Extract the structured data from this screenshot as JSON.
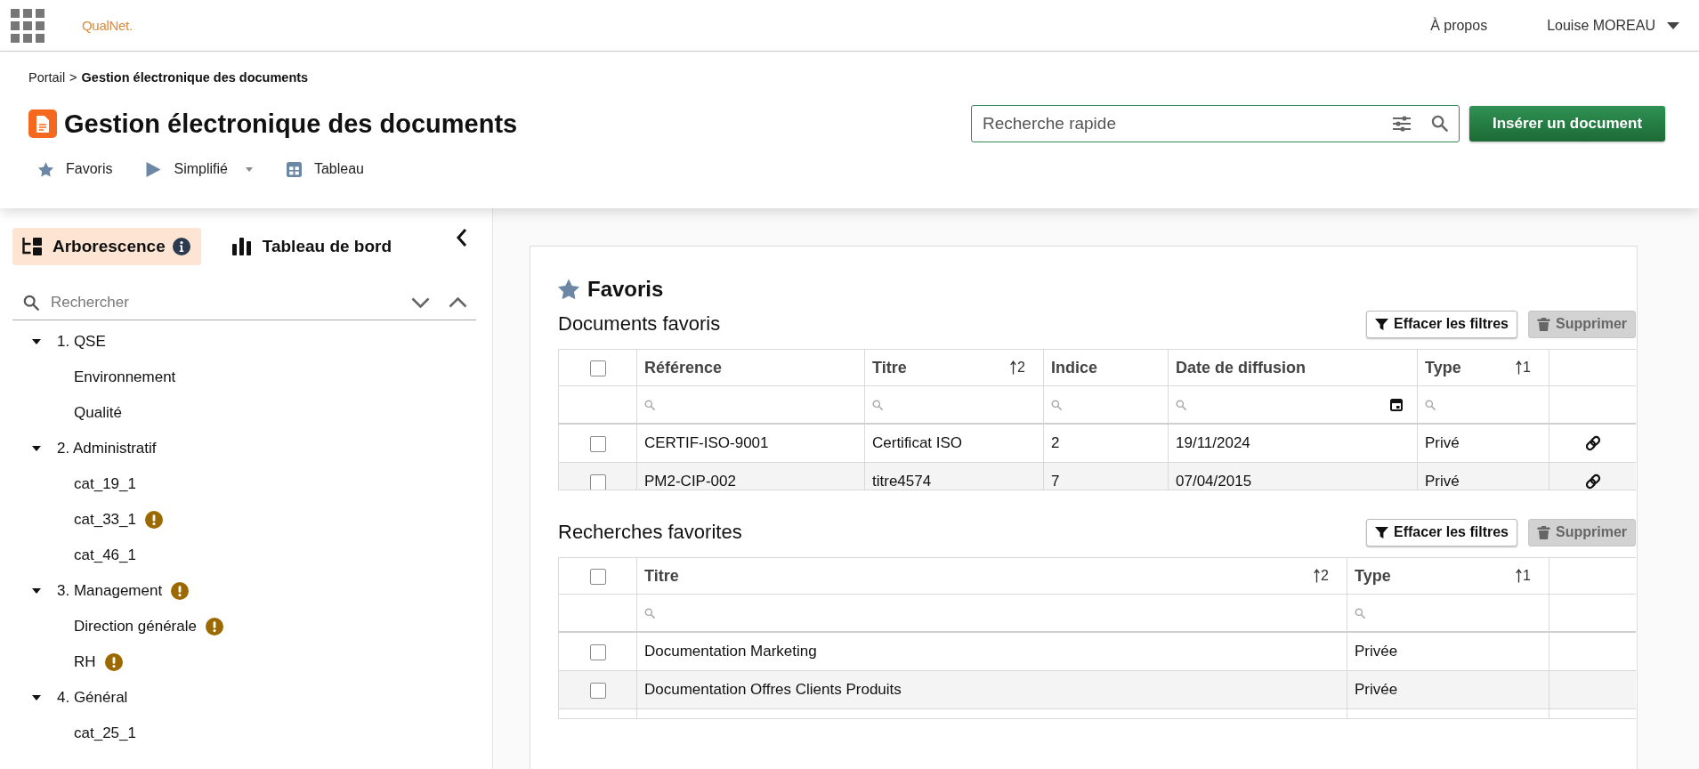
{
  "top_bar": {
    "logo": "QualNet.",
    "links": [
      {
        "label": "À propos"
      }
    ],
    "user": {
      "name": "Louise MOREAU"
    }
  },
  "header": {
    "breadcrumb": {
      "items": [
        {
          "label": "Portail",
          "current": false
        },
        {
          "label": "Gestion électronique des documents",
          "current": true
        }
      ],
      "separator": ">"
    },
    "title": "Gestion électronique des documents",
    "views": [
      {
        "label": "Favoris",
        "dropdown": false
      },
      {
        "label": "Simplifié",
        "dropdown": true
      },
      {
        "label": "Tableau",
        "dropdown": false
      }
    ],
    "search": {
      "placeholder": "Recherche rapide"
    },
    "insert_button": "Insérer un document"
  },
  "sidebar": {
    "tabs": [
      {
        "label": "Arborescence",
        "selected": true
      },
      {
        "label": "Tableau de bord",
        "selected": false
      }
    ],
    "search": {
      "placeholder": "Rechercher"
    },
    "tree": [
      {
        "label": "1. QSE",
        "expanded": true,
        "warning": false,
        "children": [
          {
            "label": "Environnement",
            "warning": false
          },
          {
            "label": "Qualité",
            "warning": false
          }
        ]
      },
      {
        "label": "2. Administratif",
        "expanded": true,
        "warning": false,
        "children": [
          {
            "label": "cat_19_1",
            "warning": false
          },
          {
            "label": "cat_33_1",
            "warning": true
          },
          {
            "label": "cat_46_1",
            "warning": false
          }
        ]
      },
      {
        "label": "3. Management",
        "expanded": true,
        "warning": true,
        "children": [
          {
            "label": "Direction générale",
            "warning": true
          },
          {
            "label": "RH",
            "warning": true
          }
        ]
      },
      {
        "label": "4. Général",
        "expanded": true,
        "warning": false,
        "children": [
          {
            "label": "cat_25_1",
            "warning": false
          }
        ]
      }
    ]
  },
  "favorites": {
    "title": "Favoris",
    "sections": [
      {
        "title": "Documents favoris",
        "buttons": [
          {
            "label": "Effacer les filtres",
            "kind": "filter",
            "disabled": false
          },
          {
            "label": "Supprimer",
            "kind": "delete",
            "disabled": true
          }
        ],
        "header_checked": false,
        "columns": [
          {
            "label": "Référence",
            "kind": "text"
          },
          {
            "label": "Titre",
            "sort": "2",
            "kind": "text"
          },
          {
            "label": "Indice",
            "kind": "text"
          },
          {
            "label": "Date de diffusion",
            "kind": "date"
          },
          {
            "label": "Type",
            "sort": "1",
            "kind": "text"
          }
        ],
        "rows": [
          {
            "checked": false,
            "link": true,
            "cells": [
              "CERTIF-ISO-9001",
              "Certificat ISO",
              "2",
              "19/11/2024",
              "Privé"
            ]
          },
          {
            "checked": false,
            "link": true,
            "cells": [
              "PM2-CIP-002",
              "titre4574",
              "7",
              "07/04/2015",
              "Privé"
            ]
          }
        ]
      },
      {
        "title": "Recherches favorites",
        "buttons": [
          {
            "label": "Effacer les filtres",
            "kind": "filter",
            "disabled": false
          },
          {
            "label": "Supprimer",
            "kind": "delete",
            "disabled": true
          }
        ],
        "header_checked": false,
        "columns": [
          {
            "label": "Titre",
            "sort": "2",
            "kind": "text"
          },
          {
            "label": "Type",
            "sort": "1",
            "kind": "text"
          }
        ],
        "rows": [
          {
            "checked": false,
            "cells": [
              "Documentation Marketing",
              "Privée"
            ]
          },
          {
            "checked": false,
            "cells": [
              "Documentation Offres Clients Produits",
              "Privée"
            ]
          }
        ]
      }
    ]
  }
}
